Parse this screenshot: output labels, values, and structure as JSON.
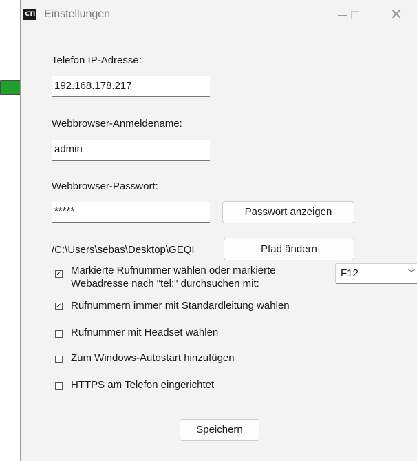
{
  "window": {
    "title": "Einstellungen",
    "app_icon_text": "CTI",
    "close_glyph": "✕"
  },
  "form": {
    "ip_label": "Telefon IP-Adresse:",
    "ip_value": "192.168.178.217",
    "username_label": "Webbrowser-Anmeldename:",
    "username_value": "admin",
    "password_label": "Webbrowser-Passwort:",
    "password_value": "*****",
    "show_password_button": "Passwort anzeigen",
    "path_text": "/C:\\Users\\sebas\\Desktop\\GEQI",
    "change_path_button": "Pfad ändern"
  },
  "options": [
    {
      "label": "Markierte Rufnummer wählen oder markierte Webadresse nach \"tel:\" durchsuchen mit:",
      "checked": true
    },
    {
      "label": "Rufnummern immer mit Standardleitung wählen",
      "checked": true
    },
    {
      "label": "Rufnummer mit Headset wählen",
      "checked": false
    },
    {
      "label": "Zum Windows-Autostart hinzufügen",
      "checked": false
    },
    {
      "label": "HTTPS am Telefon eingerichtet",
      "checked": false
    }
  ],
  "hotkey": {
    "selected": "F12"
  },
  "footer": {
    "save_button": "Speichern"
  },
  "colors": {
    "arrow_fill": "#1fa02c",
    "window_bg": "#f3f3f3"
  },
  "icons": {
    "arrow": "green-right-arrow-icon",
    "dropdown": "chevron-down-icon"
  }
}
